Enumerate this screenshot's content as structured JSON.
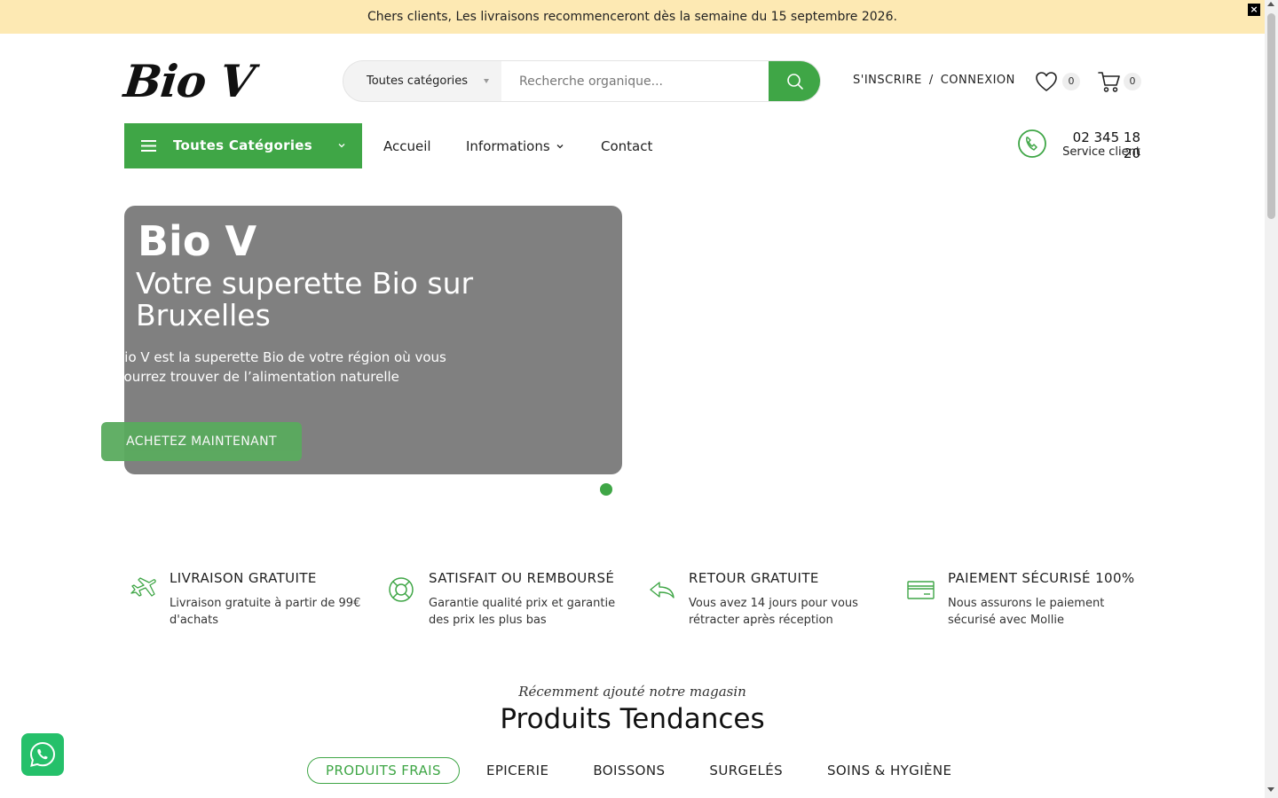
{
  "announcement": {
    "text": "Chers clients, Les livraisons recommenceront dès la semaine du 15 septembre 2026.",
    "close": "×"
  },
  "logo": {
    "text": "Bio V"
  },
  "search": {
    "category": "Toutes catégories",
    "placeholder": "Recherche organique...",
    "value": ""
  },
  "account": {
    "register": "S'INSCRIRE",
    "separator": "/",
    "login": "CONNEXION"
  },
  "wishlist": {
    "count": "0"
  },
  "cart": {
    "count": "0"
  },
  "nav": {
    "all_categories": "Toutes Catégories",
    "items": [
      {
        "label": "Accueil"
      },
      {
        "label": "Informations"
      },
      {
        "label": "Contact"
      }
    ]
  },
  "support": {
    "phone": "02 345 18 20",
    "label": "Service client"
  },
  "hero": {
    "title": "Bio V",
    "subtitle": "Votre superette Bio sur Bruxelles",
    "description": "Bio V est la superette Bio de votre région où vous pourrez trouver de l’alimentation naturelle",
    "button": "ACHETEZ MAINTENANT"
  },
  "features": [
    {
      "title": "LIVRAISON GRATUITE",
      "text": "Livraison gratuite à partir de 99€ d'achats",
      "icon": "plane-icon"
    },
    {
      "title": "SATISFAIT OU REMBOURSÉ",
      "text": "Garantie qualité prix et garantie des prix les plus bas",
      "icon": "lifebuoy-icon"
    },
    {
      "title": "RETOUR GRATUITE",
      "text": "Vous avez 14 jours pour vous rétracter après réception",
      "icon": "reply-icon"
    },
    {
      "title": "PAIEMENT SÉCURISÉ 100%",
      "text": "Nous assurons le paiement sécurisé avec Mollie",
      "icon": "credit-card-icon"
    }
  ],
  "products_section": {
    "kicker": "Récemment ajouté notre magasin",
    "title": "Produits Tendances",
    "tabs": [
      "PRODUITS FRAIS",
      "EPICERIE",
      "BOISSONS",
      "SURGELÉS",
      "SOINS & HYGIÈNE"
    ],
    "active_tab": "PRODUITS FRAIS"
  },
  "colors": {
    "accent": "#3fa646",
    "announcement_bg": "#fde9b3",
    "hero_bg": "#808080"
  }
}
